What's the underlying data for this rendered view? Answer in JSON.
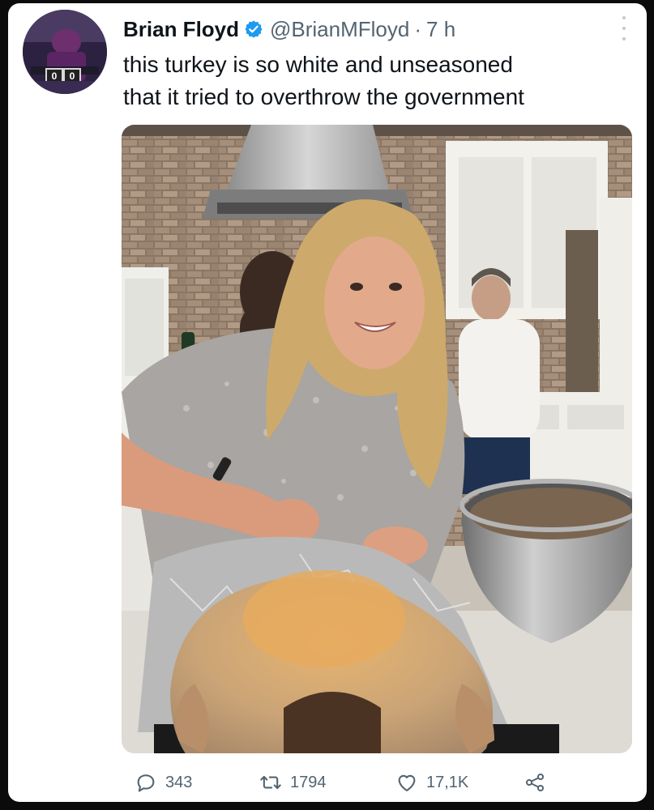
{
  "tweet": {
    "author_name": "Brian Floyd",
    "handle": "@BrianMFloyd",
    "separator": "·",
    "time": "7 h",
    "text_lines": [
      "this turkey is so white and unseasoned",
      "that it tried to overthrow the government"
    ]
  },
  "avatar": {
    "scoreboard": [
      "0",
      "0"
    ]
  },
  "actions": {
    "replies": "343",
    "retweets": "1794",
    "likes": "17,1K"
  },
  "icons": {
    "verified": "verified-badge-icon",
    "more": "more-options-icon",
    "reply": "reply-icon",
    "retweet": "retweet-icon",
    "like": "like-icon",
    "share": "share-icon"
  },
  "colors": {
    "verified_blue": "#1d9bf0",
    "muted_text": "#536471",
    "primary_text": "#0f1419"
  }
}
